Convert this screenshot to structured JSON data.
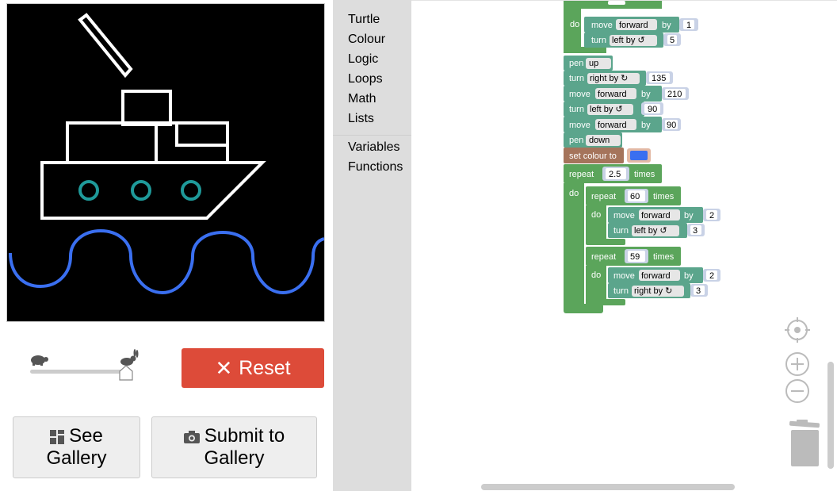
{
  "left_panel": {
    "reset_label": "Reset",
    "gallery": {
      "line1": "See",
      "line2": "Gallery"
    },
    "submit": {
      "line1": "Submit to",
      "line2": "Gallery"
    }
  },
  "toolbox": {
    "categories": [
      "Turtle",
      "Colour",
      "Logic",
      "Loops",
      "Math",
      "Lists"
    ],
    "extra": [
      "Variables",
      "Functions"
    ]
  },
  "colors": {
    "turtle_block": "#5ba58c",
    "loop_block": "#5ba55b",
    "colour_block": "#a5745b",
    "pen_colour": "#3a6ff0",
    "reset": "#dd4b39",
    "porthole": "#1f9a9a"
  },
  "blocks": {
    "row0": {
      "do": "do",
      "move": "move",
      "dir": "forward",
      "by": "by",
      "val": "1"
    },
    "row1": {
      "turn": "turn",
      "dir": "left by ↺",
      "val": "5"
    },
    "pen_up": {
      "pen": "pen",
      "state": "up"
    },
    "turn1": {
      "turn": "turn",
      "dir": "right by ↻",
      "val": "135"
    },
    "move1": {
      "move": "move",
      "dir": "forward",
      "by": "by",
      "val": "210"
    },
    "turn2": {
      "turn": "turn",
      "dir": "left by ↺",
      "val": "90"
    },
    "move2": {
      "move": "move",
      "dir": "forward",
      "by": "by",
      "val": "90"
    },
    "pen_down": {
      "pen": "pen",
      "state": "down"
    },
    "set_colour": {
      "label": "set colour to"
    },
    "repeat_outer": {
      "repeat": "repeat",
      "val": "2.5",
      "times": "times",
      "do": "do"
    },
    "repeat_a": {
      "repeat": "repeat",
      "val": "60",
      "times": "times",
      "do": "do"
    },
    "move_a": {
      "move": "move",
      "dir": "forward",
      "by": "by",
      "val": "2"
    },
    "turn_a": {
      "turn": "turn",
      "dir": "left by ↺",
      "val": "3"
    },
    "repeat_b": {
      "repeat": "repeat",
      "val": "59",
      "times": "times",
      "do": "do"
    },
    "move_b": {
      "move": "move",
      "dir": "forward",
      "by": "by",
      "val": "2"
    },
    "turn_b": {
      "turn": "turn",
      "dir": "right by ↻",
      "val": "3"
    }
  }
}
